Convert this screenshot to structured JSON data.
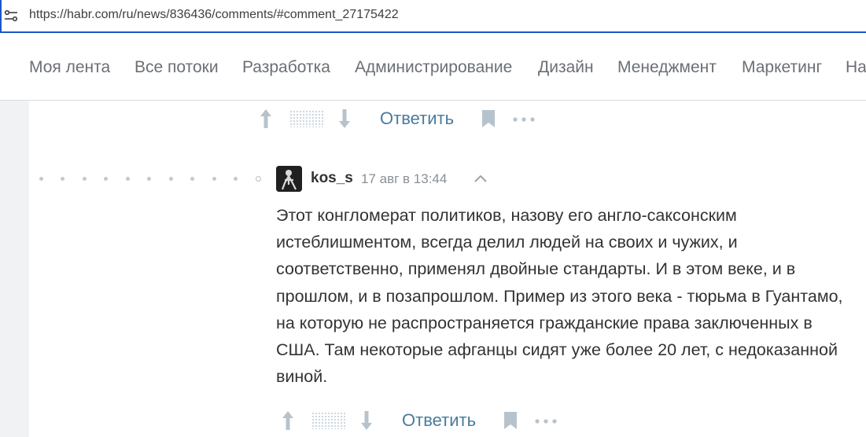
{
  "browser": {
    "url": "https://habr.com/ru/news/836436/comments/#comment_27175422"
  },
  "nav": {
    "items": [
      "Моя лента",
      "Все потоки",
      "Разработка",
      "Администрирование",
      "Дизайн",
      "Менеджмент",
      "Маркетинг",
      "На"
    ]
  },
  "top_actions": {
    "reply_label": "Ответить"
  },
  "comment": {
    "username": "kos_s",
    "date": "17 авг в 13:44",
    "text": "Этот конгломерат политиков, назову его англо-саксонским истеблишментом, всегда делил людей на своих и чужих, и соответственно, применял двойные стандарты. И в этом веке, и в прошлом, и в позапрошлом. Пример из этого века - тюрьма в Гуантамо, на которую не распространяется гражданские права заключенных в США. Там некоторые афганцы сидят уже более 20 лет, с недоказанной виной.",
    "reply_label": "Ответить"
  },
  "colors": {
    "accent": "#4a7b9d",
    "address_focus": "#1a56c8"
  }
}
